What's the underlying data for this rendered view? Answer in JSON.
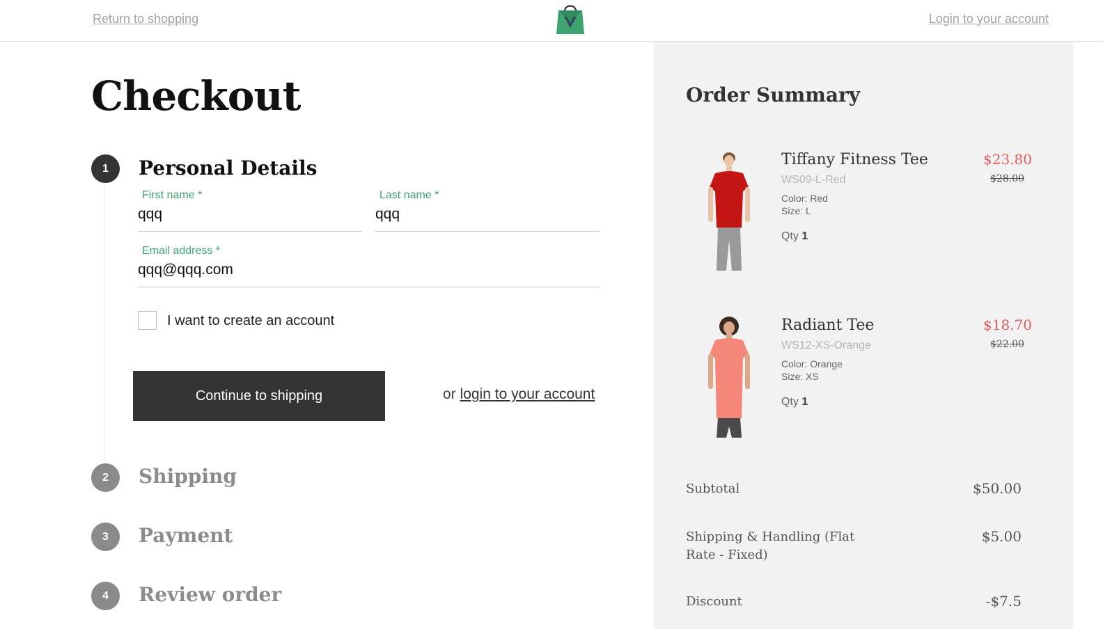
{
  "header": {
    "return_link": "Return to shopping",
    "login_link": "Login to your account",
    "logo_icon": "shopping-bag-icon",
    "logo_color": "#3fa271"
  },
  "checkout": {
    "title": "Checkout",
    "steps": [
      {
        "number": "1",
        "title": "Personal Details",
        "active": true
      },
      {
        "number": "2",
        "title": "Shipping",
        "active": false
      },
      {
        "number": "3",
        "title": "Payment",
        "active": false
      },
      {
        "number": "4",
        "title": "Review order",
        "active": false
      }
    ],
    "personal": {
      "first_name_label": "First name *",
      "first_name_value": "qqq",
      "last_name_label": "Last name *",
      "last_name_value": "qqq",
      "email_label": "Email address *",
      "email_value": "qqq@qqq.com",
      "create_account_label": "I want to create an account",
      "continue_label": "Continue to shipping",
      "or_text": "or",
      "login_link": "login to your account"
    }
  },
  "summary": {
    "title": "Order Summary",
    "products": [
      {
        "name": "Tiffany Fitness Tee",
        "sku": "WS09-L-Red",
        "color": "Color: Red",
        "size": "Size: L",
        "qty_label": "Qty",
        "qty": "1",
        "price": "$23.80",
        "old_price": "$28.00",
        "shirt_color": "#c41515"
      },
      {
        "name": "Radiant Tee",
        "sku": "WS12-XS-Orange",
        "color": "Color: Orange",
        "size": "Size: XS",
        "qty_label": "Qty",
        "qty": "1",
        "price": "$18.70",
        "old_price": "$22.00",
        "shirt_color": "#f4877a"
      }
    ],
    "totals": [
      {
        "label": "Subtotal",
        "value": "$50.00"
      },
      {
        "label": "Shipping & Handling (Flat Rate - Fixed)",
        "value": "$5.00"
      },
      {
        "label": "Discount",
        "value": "-$7.5"
      }
    ]
  },
  "colors": {
    "accent_green": "#3fa271",
    "sale_red": "#e05d5d",
    "dark": "#333333"
  }
}
